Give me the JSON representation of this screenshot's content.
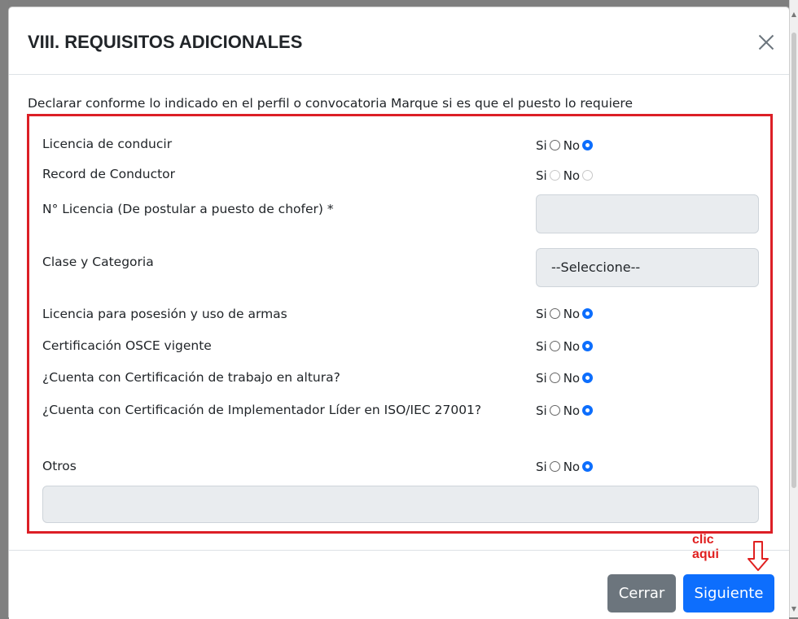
{
  "modal": {
    "title": "VIII. REQUISITOS ADICIONALES",
    "close_icon": "close-icon",
    "intro": "Declarar conforme lo indicado en el perfil o convocatoria Marque si es que el puesto lo requiere"
  },
  "requirements": {
    "rows": [
      {
        "label": "Licencia de conducir",
        "yes_label": "Si",
        "no_label": "No",
        "selected": "No",
        "disabled": false
      },
      {
        "label": "Record de Conductor",
        "yes_label": "Si",
        "no_label": "No",
        "selected": "",
        "disabled": true
      },
      {
        "label": "N° Licencia (De postular a puesto de chofer) *",
        "value": ""
      },
      {
        "label": "Clase y Categoria",
        "selected_option": "--Seleccione--"
      },
      {
        "label": "Licencia para posesión y uso de armas",
        "yes_label": "Si",
        "no_label": "No",
        "selected": "No",
        "disabled": false
      },
      {
        "label": "Certificación OSCE vigente",
        "yes_label": "Si",
        "no_label": "No",
        "selected": "No",
        "disabled": false
      },
      {
        "label": "¿Cuenta con Certificación de trabajo en altura?",
        "yes_label": "Si",
        "no_label": "No",
        "selected": "No",
        "disabled": false
      },
      {
        "label": "¿Cuenta con Certificación de Implementador Líder en ISO/IEC 27001?",
        "yes_label": "Si",
        "no_label": "No",
        "selected": "No",
        "disabled": false
      },
      {
        "label": "Otros",
        "yes_label": "Si",
        "no_label": "No",
        "selected": "No",
        "disabled": false
      }
    ],
    "others_value": ""
  },
  "footer": {
    "close_label": "Cerrar",
    "next_label": "Siguiente"
  },
  "annotation": {
    "line1": "clic",
    "line2": "aqui",
    "arrow_icon": "down-arrow-icon"
  },
  "colors": {
    "primary": "#0d6efd",
    "secondary": "#6c757d",
    "highlight": "#dc1f26"
  }
}
